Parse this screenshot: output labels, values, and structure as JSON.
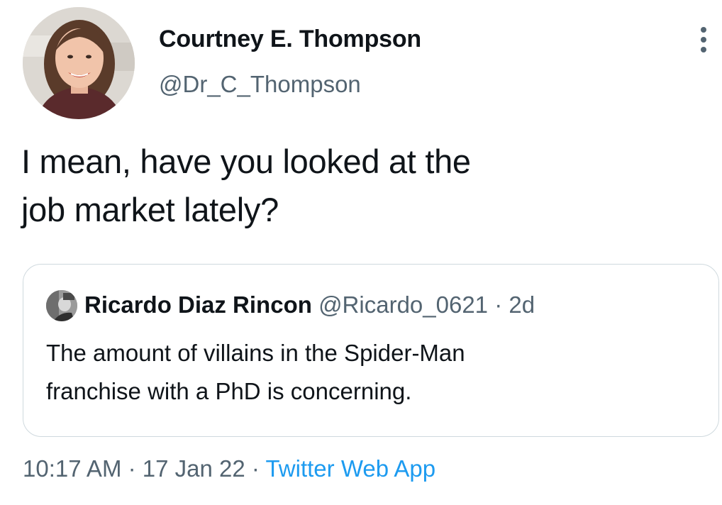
{
  "author": {
    "name": "Courtney E. Thompson",
    "handle": "@Dr_C_Thompson",
    "avatar": "profile-photo"
  },
  "tweet": {
    "text_line_1": "I mean, have you looked at the",
    "text_line_2": "job market lately?"
  },
  "quoted_tweet": {
    "name": "Ricardo Diaz Rincon",
    "handle": "@Ricardo_0621",
    "separator": " · ",
    "time": "2d",
    "text_line_1": "The amount of villains in the Spider-Man",
    "text_line_2": "franchise with a PhD is concerning."
  },
  "meta": {
    "time": "10:17 AM",
    "separator_1": " · ",
    "date": "17 Jan 22",
    "separator_2": " · ",
    "source": "Twitter Web App"
  },
  "icons": {
    "more": "more-options-icon"
  },
  "colors": {
    "text": "#0f1419",
    "secondary": "#536471",
    "link": "#1d9bf0",
    "border": "#cfd9de"
  }
}
